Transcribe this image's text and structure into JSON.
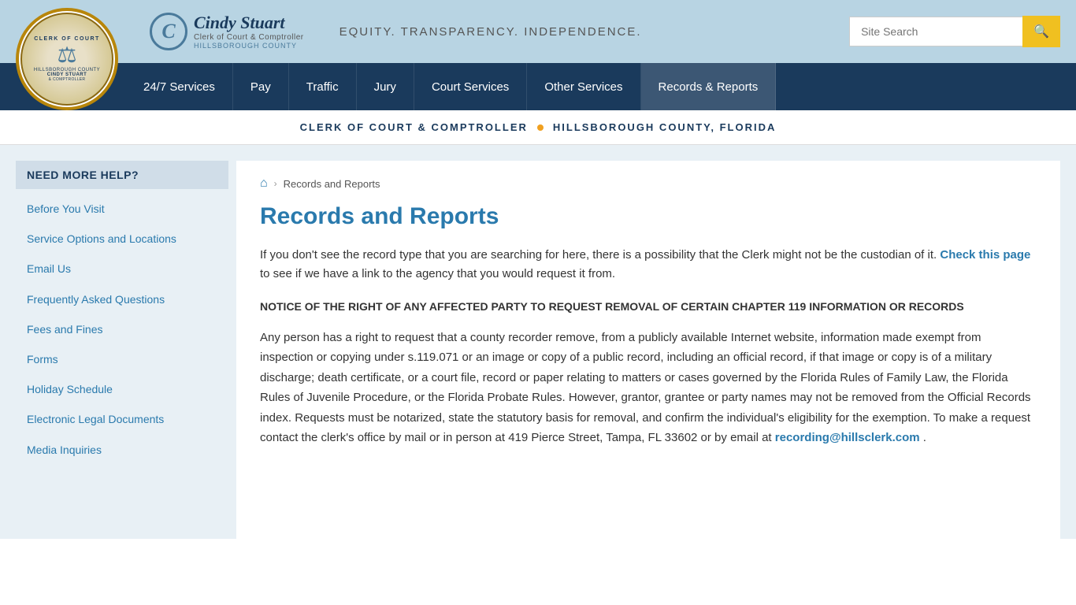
{
  "header": {
    "tagline": "EQUITY. TRANSPARENCY. INDEPENDENCE.",
    "brand_name": "Cindy Stuart",
    "brand_sub": "Clerk of Court & Comptroller",
    "brand_county": "HILLSBOROUGH COUNTY",
    "search_placeholder": "Site Search"
  },
  "nav": {
    "items": [
      {
        "label": "24/7 Services",
        "id": "247-services"
      },
      {
        "label": "Pay",
        "id": "pay"
      },
      {
        "label": "Traffic",
        "id": "traffic"
      },
      {
        "label": "Jury",
        "id": "jury"
      },
      {
        "label": "Court Services",
        "id": "court-services"
      },
      {
        "label": "Other Services",
        "id": "other-services"
      },
      {
        "label": "Records & Reports",
        "id": "records-reports"
      }
    ]
  },
  "sub_header": {
    "left": "CLERK OF COURT & COMPTROLLER",
    "right": "HILLSBOROUGH COUNTY, FLORIDA"
  },
  "sidebar": {
    "title": "NEED MORE HELP?",
    "links": [
      {
        "label": "Before You Visit",
        "id": "before-you-visit"
      },
      {
        "label": "Service Options and Locations",
        "id": "service-options"
      },
      {
        "label": "Email Us",
        "id": "email-us"
      },
      {
        "label": "Frequently Asked Questions",
        "id": "faq"
      },
      {
        "label": "Fees and Fines",
        "id": "fees-fines"
      },
      {
        "label": "Forms",
        "id": "forms"
      },
      {
        "label": "Holiday Schedule",
        "id": "holiday-schedule"
      },
      {
        "label": "Electronic Legal Documents",
        "id": "electronic-legal"
      },
      {
        "label": "Media Inquiries",
        "id": "media-inquiries"
      }
    ]
  },
  "breadcrumb": {
    "home_icon": "⌂",
    "current": "Records and Reports"
  },
  "content": {
    "page_title": "Records and Reports",
    "intro": "If you don't see the record type that you are searching for here, there is a possibility that the Clerk might not be the custodian of it.",
    "check_link_text": "Check this page",
    "intro_cont": " to see if we have a link to the agency that you would request it from.",
    "notice_title": "NOTICE OF THE RIGHT OF ANY AFFECTED PARTY TO REQUEST REMOVAL OF CERTAIN CHAPTER 119 INFORMATION OR RECORDS",
    "body_text": "Any person has a right to request that a county recorder remove, from a publicly available Internet website, information made exempt from inspection or copying under s.119.071 or an image or copy of a public record, including an official record, if that image or copy is of a military discharge; death certificate, or a court file, record or paper relating to matters or cases governed by the Florida Rules of Family Law, the Florida Rules of Juvenile Procedure, or the Florida Probate Rules. However, grantor, grantee or party names may not be removed from the Official Records index. Requests must be notarized, state the statutory basis for removal, and confirm the individual's eligibility for the exemption. To make a request contact the clerk's office by mail or in person at 419 Pierce Street, Tampa, FL 33602 or by email at",
    "email_link": "recording@hillsclerk.com",
    "body_end": "."
  }
}
